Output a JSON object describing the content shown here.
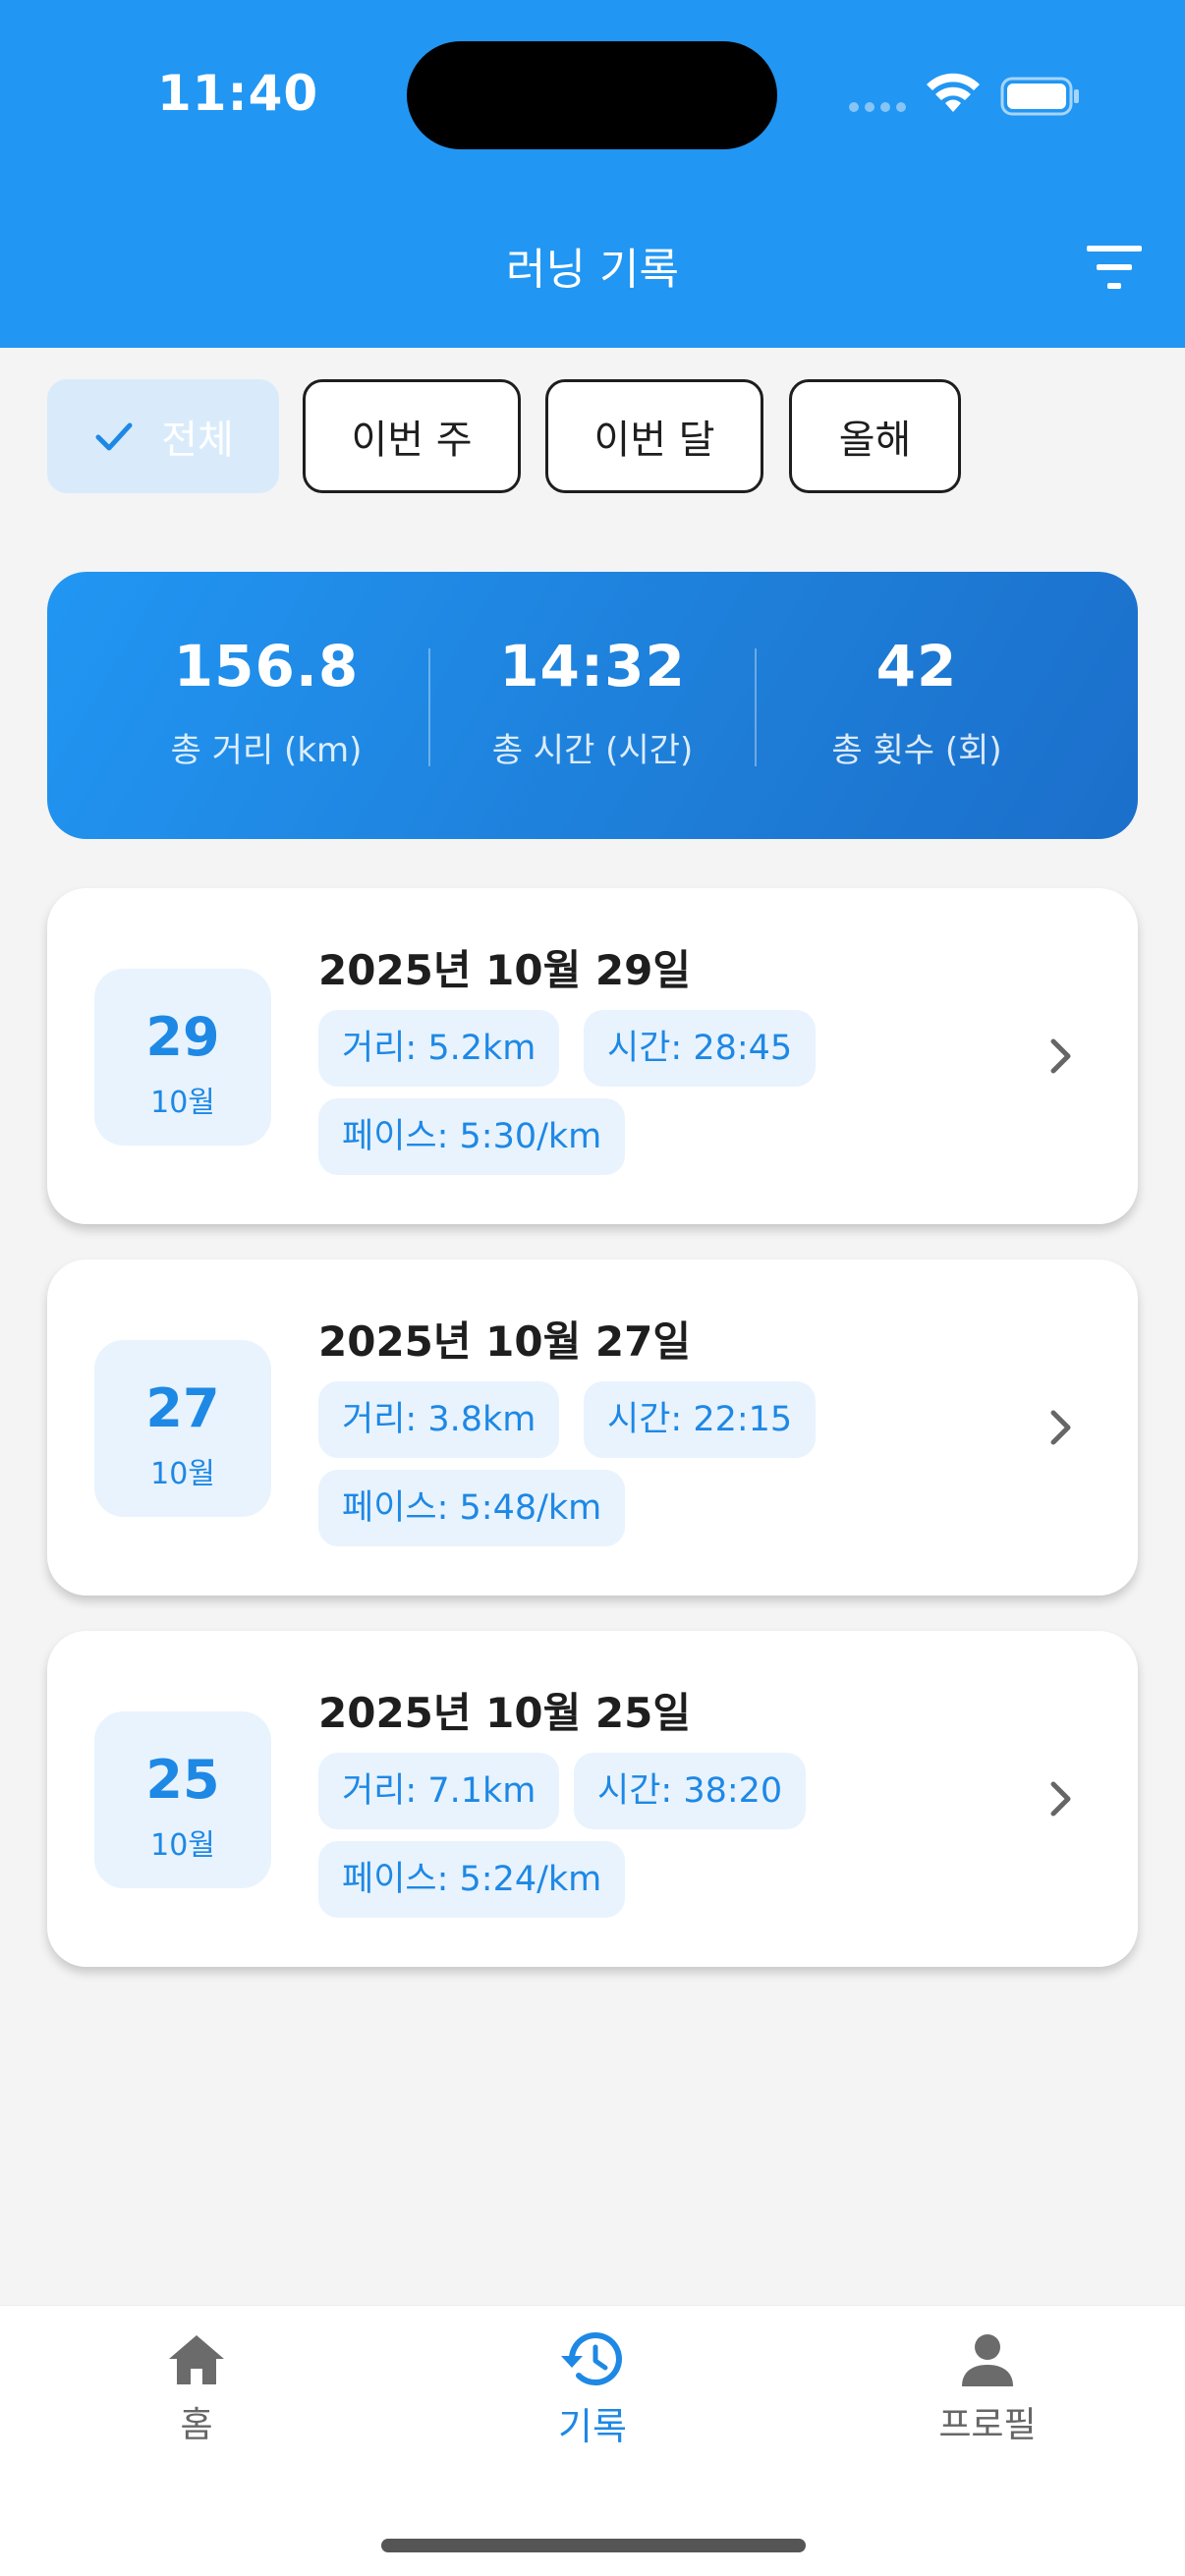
{
  "status_bar": {
    "time": "11:40"
  },
  "header": {
    "title": "러닝 기록"
  },
  "filters": [
    {
      "label": "전체",
      "selected": true
    },
    {
      "label": "이번 주",
      "selected": false
    },
    {
      "label": "이번 달",
      "selected": false
    },
    {
      "label": "올해",
      "selected": false
    }
  ],
  "summary": {
    "distance": {
      "value": "156.8",
      "label": "총 거리 (km)"
    },
    "time": {
      "value": "14:32",
      "label": "총 시간 (시간)"
    },
    "count": {
      "value": "42",
      "label": "총 횟수 (회)"
    }
  },
  "runs": [
    {
      "day": "29",
      "month": "10월",
      "title": "2025년 10월 29일",
      "distance": "거리: 5.2km",
      "time": "시간: 28:45",
      "pace": "페이스: 5:30/km"
    },
    {
      "day": "27",
      "month": "10월",
      "title": "2025년 10월 27일",
      "distance": "거리: 3.8km",
      "time": "시간: 22:15",
      "pace": "페이스: 5:48/km"
    },
    {
      "day": "25",
      "month": "10월",
      "title": "2025년 10월 25일",
      "distance": "거리: 7.1km",
      "time": "시간: 38:20",
      "pace": "페이스: 5:24/km"
    }
  ],
  "nav": {
    "home": "홈",
    "history": "기록",
    "profile": "프로필",
    "active": "history"
  },
  "colors": {
    "primary": "#2196F3",
    "accent_text": "#1E88E5",
    "tag_bg": "#E8F3FD",
    "page_bg": "#F4F4F4"
  },
  "icons": [
    "check-icon",
    "filter-icon",
    "wifi-icon",
    "battery-icon",
    "chevron-right-icon",
    "home-icon",
    "history-icon",
    "person-icon"
  ]
}
